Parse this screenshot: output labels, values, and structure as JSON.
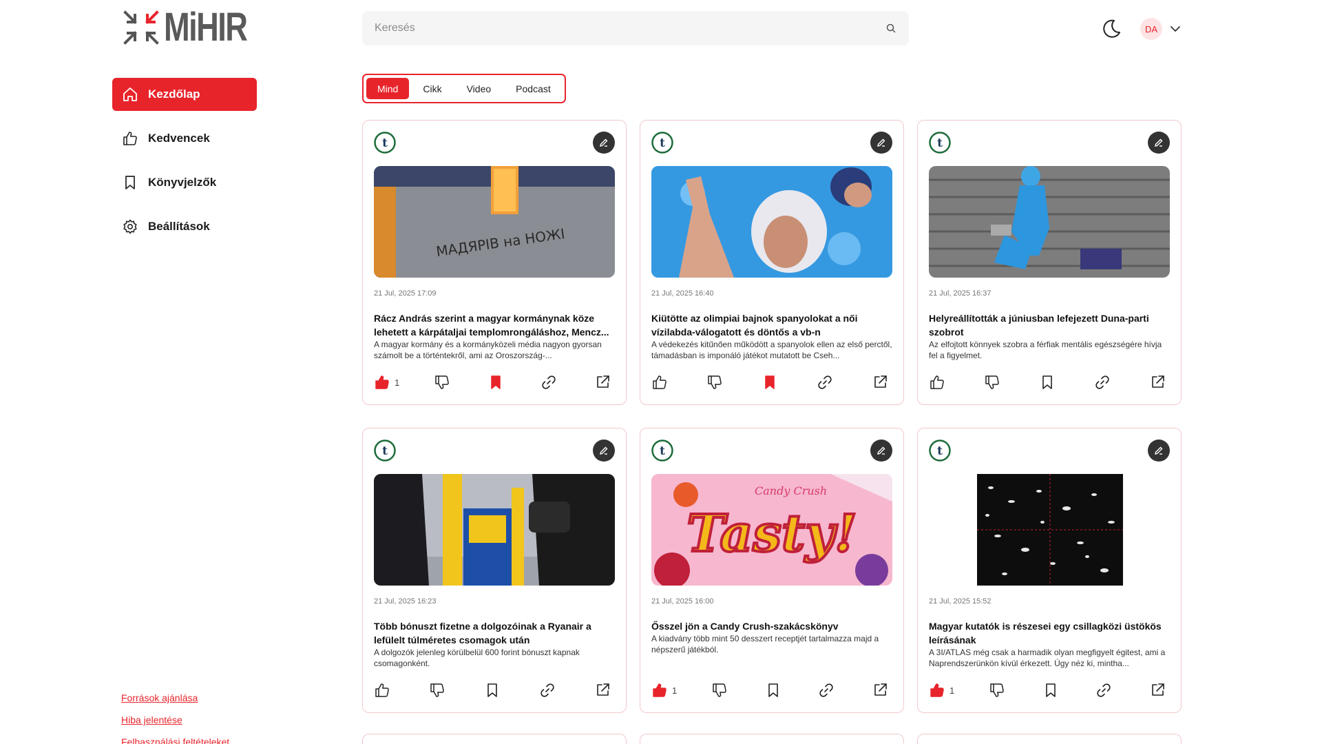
{
  "app": {
    "logo_text": "MiHIR"
  },
  "sidebar": {
    "items": [
      {
        "label": "Kezdőlap",
        "icon": "home-icon",
        "active": true
      },
      {
        "label": "Kedvencek",
        "icon": "thumbs-up-icon",
        "active": false
      },
      {
        "label": "Könyvjelzők",
        "icon": "bookmark-icon",
        "active": false
      },
      {
        "label": "Beállítások",
        "icon": "gear-icon",
        "active": false
      }
    ],
    "footer_links": [
      {
        "label": "Források ajánlása"
      },
      {
        "label": "Hiba jelentése"
      },
      {
        "label": "Felhasználási feltételeket"
      }
    ]
  },
  "header": {
    "search_placeholder": "Keresés",
    "avatar_initials": "DA"
  },
  "filter_tabs": [
    {
      "label": "Mind",
      "active": true
    },
    {
      "label": "Cikk",
      "active": false
    },
    {
      "label": "Video",
      "active": false
    },
    {
      "label": "Podcast",
      "active": false
    }
  ],
  "colors": {
    "accent": "#e8242b",
    "card_border": "#f1c9cb"
  },
  "articles": [
    {
      "date": "21 Jul, 2025 17:09",
      "title": "Rácz András szerint a magyar kormánynak köze lehetett a kárpátaljai templomrongáláshoz, Mencz...",
      "desc": "A magyar kormány és a kormányközeli média nagyon gyorsan számolt be a történtekről, ami az Oroszország-...",
      "liked": true,
      "likes": "1",
      "bookmarked": true,
      "image": "church-wall-graffiti"
    },
    {
      "date": "21 Jul, 2025 16:40",
      "title": "Kiütötte az olimpiai bajnok spanyolokat a női vízilabda-válogatott és döntős a vb-n",
      "desc": "A védekezés kitűnően működött a spanyolok ellen az első perctől, támadásban is imponáló játékot mutatott be Cseh...",
      "liked": false,
      "likes": "",
      "bookmarked": true,
      "image": "water-polo-player"
    },
    {
      "date": "21 Jul, 2025 16:37",
      "title": "Helyreállították a júniusban lefejezett Duna-parti szobrot",
      "desc": "Az elfojtott könnyek szobra a férfiak mentális egészségére hívja fel a figyelmet.",
      "liked": false,
      "likes": "",
      "bookmarked": false,
      "image": "blue-statue-on-steps"
    },
    {
      "date": "21 Jul, 2025 16:23",
      "title": "Több bónuszt fizetne a dolgozóinak a Ryanair a lefülelt túlméretes csomagok után",
      "desc": "A dolgozók jelenleg körülbelül 600 forint bónuszt kapnak csomagonként.",
      "liked": false,
      "likes": "",
      "bookmarked": false,
      "image": "ryanair-bag-sizer"
    },
    {
      "date": "21 Jul, 2025 16:00",
      "title": "Ősszel jön a Candy Crush-szakácskönyv",
      "desc": "A kiadvány több mint 50 desszert receptjét tartalmazza majd a népszerű játékból.",
      "liked": true,
      "likes": "1",
      "bookmarked": false,
      "image": "candy-crush-tasty"
    },
    {
      "date": "21 Jul, 2025 15:52",
      "title": "Magyar kutatók is részesei egy csillagközi üstökös leírásának",
      "desc": "A 3I/ATLAS még csak a harmadik olyan megfigyelt égitest, ami a Naprendszerünkön kívül érkezett. Úgy néz ki, mintha...",
      "liked": true,
      "likes": "1",
      "bookmarked": false,
      "image": "comet-starfield"
    }
  ]
}
